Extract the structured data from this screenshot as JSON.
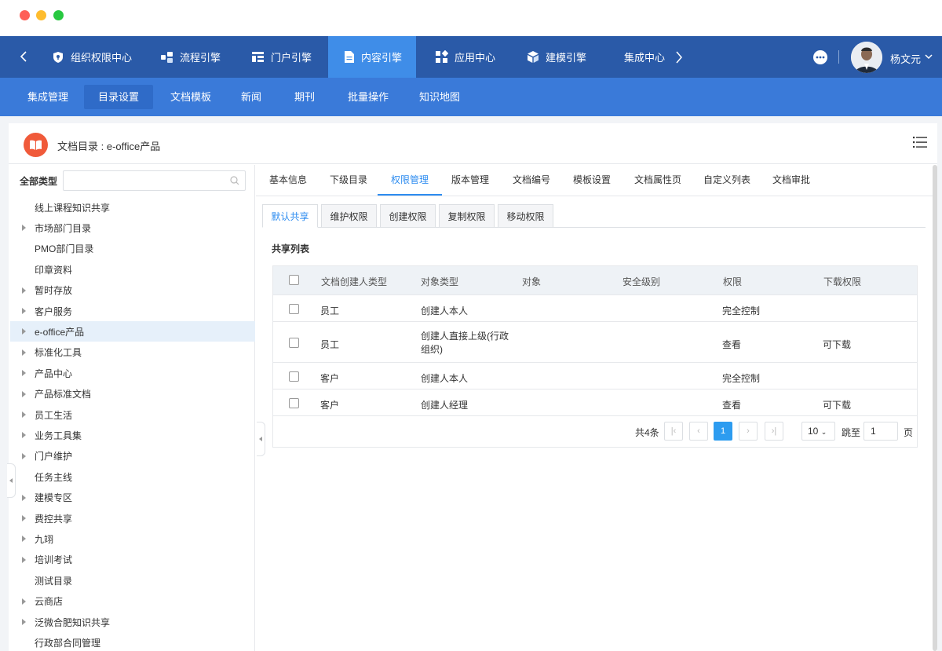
{
  "window": {
    "dot_colors": [
      "#fe5f57",
      "#febc2e",
      "#28c840"
    ]
  },
  "topnav": {
    "items": [
      {
        "label": "组织权限中心",
        "icon": "shield-icon"
      },
      {
        "label": "流程引擎",
        "icon": "flow-icon"
      },
      {
        "label": "门户引擎",
        "icon": "portal-icon"
      },
      {
        "label": "内容引擎",
        "icon": "document-icon",
        "active": true
      },
      {
        "label": "应用中心",
        "icon": "apps-icon"
      },
      {
        "label": "建模引擎",
        "icon": "cube-icon"
      },
      {
        "label": "集成中心",
        "icon": "integration-icon"
      }
    ],
    "user_name": "杨文元",
    "colors": {
      "bar": "#2a5aa8",
      "active": "#3f8de8"
    }
  },
  "subnav": {
    "items": [
      "集成管理",
      "目录设置",
      "文档模板",
      "新闻",
      "期刊",
      "批量操作",
      "知识地图"
    ],
    "active_index": 1
  },
  "header": {
    "title": "文档目录 : e-office产品"
  },
  "left": {
    "search_label": "全部类型",
    "search_placeholder": "",
    "tree": [
      {
        "label": "线上课程知识共享",
        "has_children": false
      },
      {
        "label": "市场部门目录",
        "has_children": true
      },
      {
        "label": "PMO部门目录",
        "has_children": false
      },
      {
        "label": "印章资料",
        "has_children": false
      },
      {
        "label": "暂时存放",
        "has_children": true
      },
      {
        "label": "客户服务",
        "has_children": true
      },
      {
        "label": "e-office产品",
        "has_children": true,
        "selected": true
      },
      {
        "label": "标准化工具",
        "has_children": true
      },
      {
        "label": "产品中心",
        "has_children": true
      },
      {
        "label": "产品标准文档",
        "has_children": true
      },
      {
        "label": "员工生活",
        "has_children": true
      },
      {
        "label": "业务工具集",
        "has_children": true
      },
      {
        "label": "门户维护",
        "has_children": true
      },
      {
        "label": "任务主线",
        "has_children": false
      },
      {
        "label": "建模专区",
        "has_children": true
      },
      {
        "label": "费控共享",
        "has_children": true
      },
      {
        "label": "九翊",
        "has_children": true
      },
      {
        "label": "培训考试",
        "has_children": true
      },
      {
        "label": "测试目录",
        "has_children": false
      },
      {
        "label": "云商店",
        "has_children": true
      },
      {
        "label": "泛微合肥知识共享",
        "has_children": true
      },
      {
        "label": "行政部合同管理",
        "has_children": false
      }
    ]
  },
  "tabs": [
    "基本信息",
    "下级目录",
    "权限管理",
    "版本管理",
    "文档编号",
    "模板设置",
    "文档属性页",
    "自定义列表",
    "文档审批"
  ],
  "active_tab": 2,
  "subtabs": [
    "默认共享",
    "维护权限",
    "创建权限",
    "复制权限",
    "移动权限"
  ],
  "active_subtab": 0,
  "share_title": "共享列表",
  "table": {
    "headers": [
      "文档创建人类型",
      "对象类型",
      "对象",
      "安全级别",
      "权限",
      "下载权限"
    ],
    "rows": [
      {
        "creator_type": "员工",
        "object_type": "创建人本人",
        "object": "",
        "security": "",
        "permission": "完全控制",
        "download": ""
      },
      {
        "creator_type": "员工",
        "object_type": "创建人直接上级(行政组织)",
        "object": "",
        "security": "",
        "permission": "查看",
        "download": "可下载"
      },
      {
        "creator_type": "客户",
        "object_type": "创建人本人",
        "object": "",
        "security": "",
        "permission": "完全控制",
        "download": ""
      },
      {
        "creator_type": "客户",
        "object_type": "创建人经理",
        "object": "",
        "security": "",
        "permission": "查看",
        "download": "可下载"
      }
    ]
  },
  "pager": {
    "total": "共4条",
    "current_page": "1",
    "page_size": "10",
    "jump_label": "跳至",
    "jump_value": "1",
    "page_label": "页"
  },
  "accent_color": "#2d8cf0"
}
